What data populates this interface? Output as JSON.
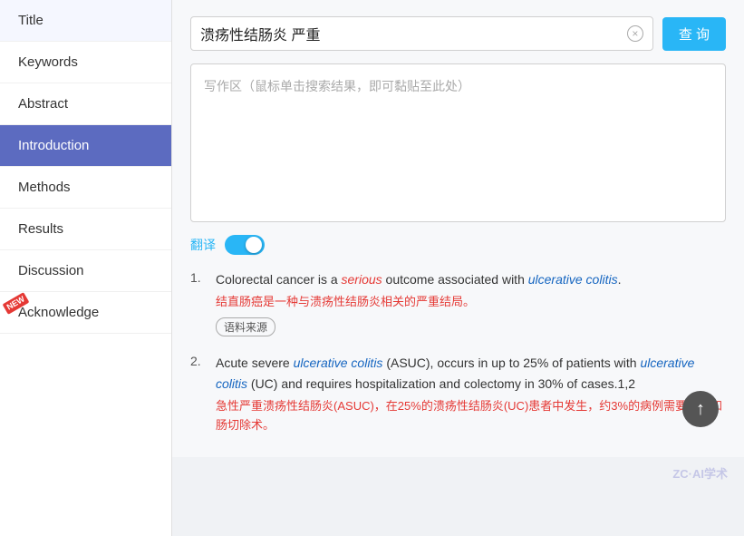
{
  "sidebar": {
    "items": [
      {
        "id": "title",
        "label": "Title",
        "active": false,
        "new": false
      },
      {
        "id": "keywords",
        "label": "Keywords",
        "active": false,
        "new": false
      },
      {
        "id": "abstract",
        "label": "Abstract",
        "active": false,
        "new": false
      },
      {
        "id": "introduction",
        "label": "Introduction",
        "active": true,
        "new": false
      },
      {
        "id": "methods",
        "label": "Methods",
        "active": false,
        "new": false
      },
      {
        "id": "results",
        "label": "Results",
        "active": false,
        "new": false
      },
      {
        "id": "discussion",
        "label": "Discussion",
        "active": false,
        "new": false
      },
      {
        "id": "acknowledge",
        "label": "Acknowledge",
        "active": false,
        "new": true
      }
    ]
  },
  "search": {
    "query": "溃疡性结肠炎 严重",
    "button_label": "查 询",
    "clear_icon": "×"
  },
  "writing_area": {
    "placeholder": "写作区（鼠标单击搜索结果，即可黏贴至此处）"
  },
  "translation": {
    "label": "翻译",
    "enabled": true
  },
  "results": [
    {
      "number": "1.",
      "en_parts": [
        {
          "text": "Colorectal cancer is a ",
          "style": "normal"
        },
        {
          "text": "serious",
          "style": "italic-red"
        },
        {
          "text": " outcome associated with ",
          "style": "normal"
        },
        {
          "text": "ulcerative colitis",
          "style": "italic-blue"
        },
        {
          "text": ".",
          "style": "normal"
        }
      ],
      "cn_parts": [
        {
          "text": "结直肠癌是一种与",
          "style": "normal"
        },
        {
          "text": "溃疡性结肠炎",
          "style": "red"
        },
        {
          "text": "相关的严重结局。",
          "style": "normal"
        }
      ],
      "source_tag": "语料来源"
    },
    {
      "number": "2.",
      "en_parts": [
        {
          "text": "Acute severe ",
          "style": "normal"
        },
        {
          "text": "ulcerative colitis",
          "style": "italic-blue"
        },
        {
          "text": " (ASUC), occurs in up to 25% of patients with ",
          "style": "normal"
        },
        {
          "text": "ulcerative colitis",
          "style": "italic-blue"
        },
        {
          "text": " (UC) and requires hospitalization and colectomy in 30% of cases.1,2",
          "style": "normal"
        }
      ],
      "cn_parts": [
        {
          "text": "急性严重",
          "style": "normal"
        },
        {
          "text": "溃疡性结肠炎",
          "style": "red"
        },
        {
          "text": "(ASUC)，在25%的",
          "style": "normal"
        },
        {
          "text": "溃疡性结肠炎",
          "style": "red"
        },
        {
          "text": "(UC)患者中发生，约3%的病例需要住院和",
          "style": "normal"
        },
        {
          "text": "肠切",
          "style": "red"
        },
        {
          "text": "除术。",
          "style": "normal"
        }
      ],
      "source_tag": null
    }
  ],
  "new_badge_label": "NEW",
  "watermark": "ZC·AI学术",
  "scroll_top_icon": "↑"
}
